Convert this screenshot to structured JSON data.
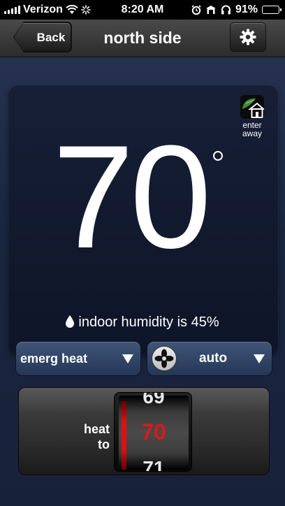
{
  "status_bar": {
    "carrier": "Verizon",
    "time": "8:20 AM",
    "battery": "91%",
    "battery_level": 0.91,
    "icons": [
      "signal-icon",
      "wifi-icon",
      "activity-spinner-icon",
      "alarm-icon",
      "clock-icon",
      "headphones-icon",
      "battery-icon"
    ]
  },
  "nav": {
    "back_label": "Back",
    "title": "north side",
    "settings_icon": "gear-icon"
  },
  "thermostat": {
    "temperature": "70",
    "away_label_1": "enter",
    "away_label_2": "away",
    "humidity_text": "indoor humidity is 45%",
    "mode": {
      "selected": "emerg heat"
    },
    "fan": {
      "selected": "auto"
    },
    "setpoint": {
      "label_1": "heat",
      "label_2": "to",
      "previous": "69",
      "current": "70",
      "next": "71"
    }
  },
  "colors": {
    "accent_red": "#d81a1a",
    "panel_bg": "#0f1528",
    "dropdown_bg": "#2d4164"
  }
}
